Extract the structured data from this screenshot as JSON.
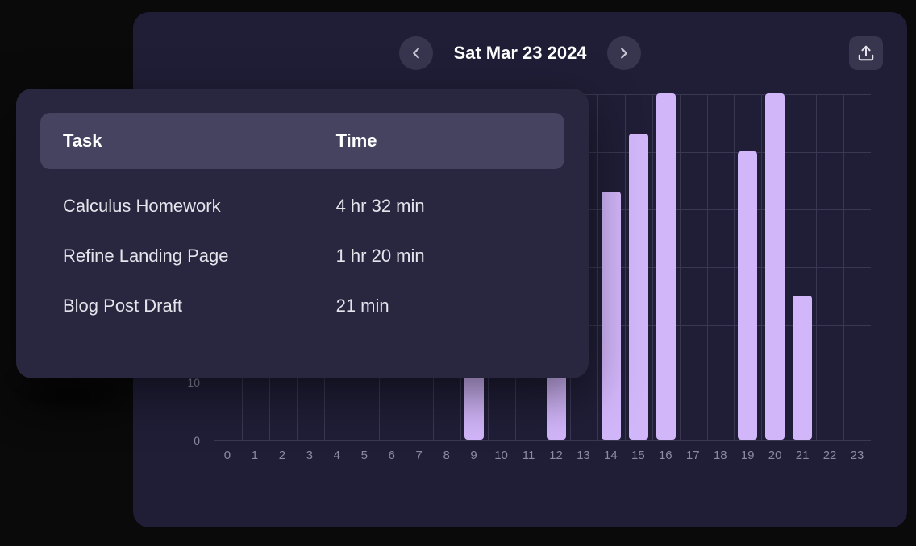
{
  "header": {
    "date": "Sat Mar 23 2024"
  },
  "tasks": {
    "columns": {
      "task": "Task",
      "time": "Time"
    },
    "rows": [
      {
        "name": "Calculus Homework",
        "time": "4 hr 32 min"
      },
      {
        "name": "Refine Landing Page",
        "time": "1 hr 20 min"
      },
      {
        "name": "Blog Post Draft",
        "time": "21 min"
      }
    ]
  },
  "chart_data": {
    "type": "bar",
    "title": "",
    "xlabel": "",
    "ylabel": "",
    "ylim": [
      0,
      60
    ],
    "y_ticks": [
      0,
      10
    ],
    "categories": [
      0,
      1,
      2,
      3,
      4,
      5,
      6,
      7,
      8,
      9,
      10,
      11,
      12,
      13,
      14,
      15,
      16,
      17,
      18,
      19,
      20,
      21,
      22,
      23
    ],
    "values": [
      0,
      0,
      0,
      0,
      0,
      0,
      0,
      0,
      0,
      17,
      0,
      0,
      14,
      0,
      43,
      53,
      60,
      0,
      0,
      50,
      60,
      25,
      0,
      0
    ]
  }
}
